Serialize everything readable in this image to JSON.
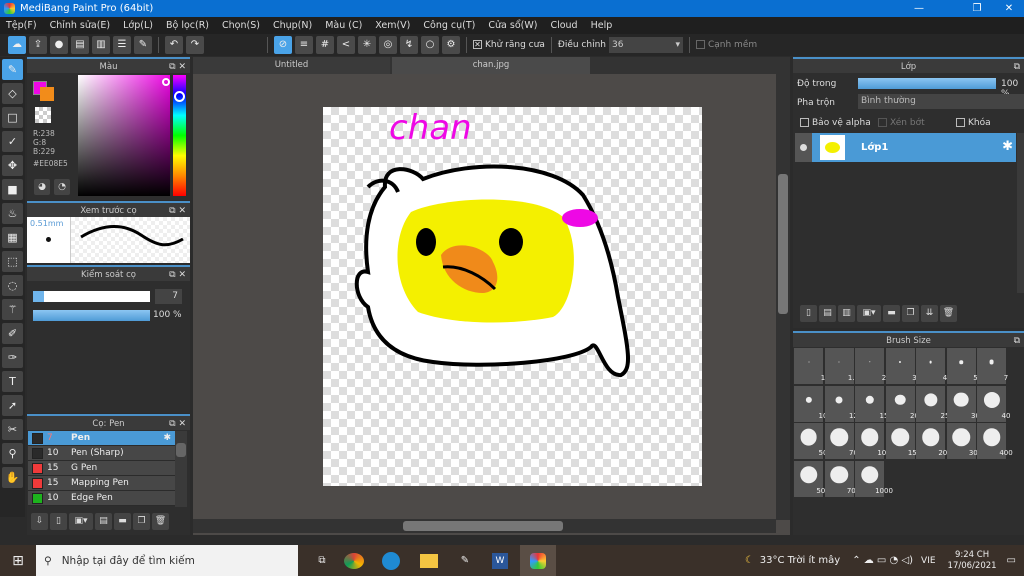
{
  "window": {
    "title": "MediBang Paint Pro (64bit)"
  },
  "menu": [
    "Tệp(F)",
    "Chỉnh sửa(E)",
    "Lớp(L)",
    "Bộ lọc(R)",
    "Chọn(S)",
    "Chụp(N)",
    "Màu (C)",
    "Xem(V)",
    "Công cụ(T)",
    "Cửa sổ(W)",
    "Cloud",
    "Help"
  ],
  "toolbar": {
    "antialias_label": "Khử răng cưa",
    "antialias_checked": true,
    "adjust_label": "Điều chỉnh",
    "adjust_value": "36",
    "soft_edge_label": "Cạnh mềm",
    "soft_edge_checked": false
  },
  "color_panel": {
    "title": "Màu",
    "primary": "#EE08E5",
    "secondary": "#F28C1A",
    "r": "R:238",
    "g": "G:8",
    "b": "B:229",
    "hex": "#EE08E5"
  },
  "brush_preview": {
    "title": "Xem trước cọ",
    "size": "0.51mm"
  },
  "brush_control": {
    "title": "Kiểm soát cọ",
    "size": "7",
    "size_fraction": 0.09,
    "opacity": "100 %",
    "opacity_fraction": 1.0
  },
  "brush_list": {
    "title": "Cọ: Pen",
    "items": [
      {
        "size": "7",
        "name": "Pen",
        "color": "#2a2a2a",
        "selected": true
      },
      {
        "size": "10",
        "name": "Pen (Sharp)",
        "color": "#2a2a2a"
      },
      {
        "size": "15",
        "name": "G Pen",
        "color": "#f03a3a"
      },
      {
        "size": "15",
        "name": "Mapping Pen",
        "color": "#f03a3a"
      },
      {
        "size": "10",
        "name": "Edge Pen",
        "color": "#1db31d"
      }
    ]
  },
  "tabs": [
    {
      "label": "Untitled"
    },
    {
      "label": "chan.jpg",
      "active": true
    }
  ],
  "canvas": {
    "drawing_text": "chan"
  },
  "layer_panel": {
    "title": "Lớp",
    "opacity_label": "Độ trong",
    "opacity": "100 %",
    "opacity_fraction": 1.0,
    "blend_label": "Pha trộn",
    "blend_value": "Bình thường",
    "protect_alpha": "Bảo vệ alpha",
    "clipping": "Xén bớt",
    "lock": "Khóa",
    "layers": [
      {
        "name": "Lớp1",
        "selected": true
      }
    ]
  },
  "brush_size": {
    "title": "Brush Size",
    "sizes": [
      "1",
      "1.5",
      "2",
      "3",
      "4",
      "5",
      "7",
      "10",
      "12",
      "15",
      "20",
      "25",
      "30",
      "40",
      "50",
      "70",
      "100",
      "150",
      "200",
      "300",
      "400",
      "500",
      "700",
      "1000"
    ]
  },
  "taskbar": {
    "search_placeholder": "Nhập tại đây để tìm kiếm",
    "weather": "33°C  Trời ít mây",
    "lang": "VIE",
    "time": "9:24 CH",
    "date": "17/06/2021"
  }
}
